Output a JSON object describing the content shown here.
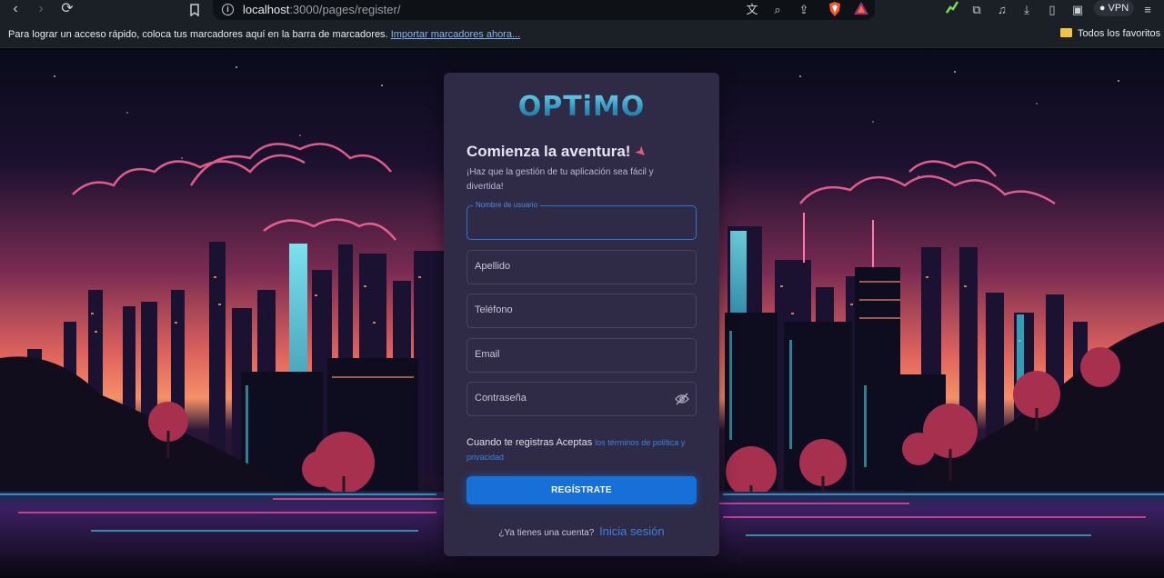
{
  "browser": {
    "url_host": "localhost",
    "url_rest": ":3000/pages/register/",
    "vpn_label": "VPN",
    "bookmarks_message": "Para lograr un acceso rápido, coloca tus marcadores aquí en la barra de marcadores.",
    "bookmarks_import_link": "Importar marcadores ahora...",
    "all_bookmarks": "Todos los favoritos"
  },
  "form": {
    "logo_text": "OPTiMO",
    "title": "Comienza la aventura!",
    "subtitle": "¡Haz que la gestión de tu aplicación sea fácil y divertida!",
    "username_label": "Nombre de usuario",
    "username_value": "",
    "apellido_label": "Apellido",
    "telefono_label": "Teléfono",
    "email_label": "Email",
    "password_label": "Contraseña",
    "terms_text": "Cuando te registras Aceptas",
    "terms_link": "los términos de política y privacidad",
    "submit_label": "REGÍSTRATE",
    "login_prompt": "¿Ya tienes una cuenta?",
    "login_link": "Inicia sesión"
  },
  "colors": {
    "card_bg": "#2f2a45",
    "accent": "#1670d8",
    "link": "#3b82e0"
  }
}
